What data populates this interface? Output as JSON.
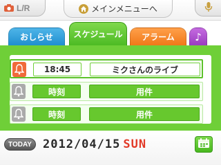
{
  "topbar": {
    "camera_button_label": "L/R",
    "menu_button_label": "メインメニューへ",
    "icons": [
      "camera-icon",
      "home-icon",
      "mic-icon"
    ]
  },
  "tabs": [
    {
      "label": "おしらせ",
      "color": "#2a9fdc",
      "active": false
    },
    {
      "label": "スケジュール",
      "color": "#5cc22a",
      "active": true
    },
    {
      "label": "アラーム",
      "color": "#f58a2c",
      "active": false
    },
    {
      "label": "♪",
      "color": "#a847cc",
      "active": false
    }
  ],
  "schedule": {
    "rows": [
      {
        "alarm_on": true,
        "time": "18:45",
        "event": "ミクさんのライブ"
      },
      {
        "alarm_on": false,
        "time": "時刻",
        "event": "用件"
      },
      {
        "alarm_on": false,
        "time": "時刻",
        "event": "用件"
      }
    ]
  },
  "footer": {
    "today_label": "TODAY",
    "date": "2012/04/15",
    "weekday": "SUN",
    "weekday_color": "#e23a28"
  }
}
